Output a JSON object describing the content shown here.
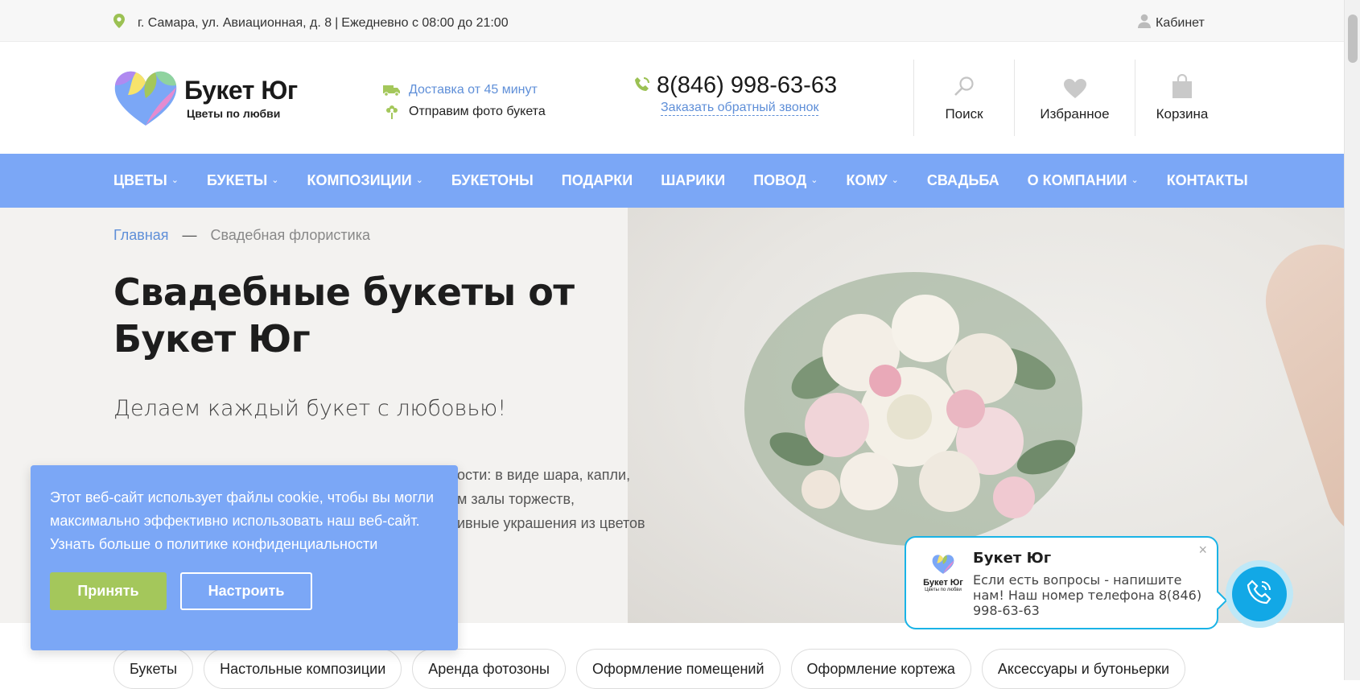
{
  "topbar": {
    "address": "г. Самара, ул. Авиационная, д. 8",
    "hours": "Ежедневно с 08:00 до 21:00",
    "cabinet": "Кабинет"
  },
  "header": {
    "logo_title": "Букет Юг",
    "logo_sub": "Цветы по любви",
    "delivery": "Доставка от 45 минут",
    "photo_send": "Отправим фото букета",
    "phone": "8(846) 998-63-63",
    "callback": "Заказать обратный звонок",
    "search": "Поиск",
    "favorites": "Избранное",
    "cart": "Корзина"
  },
  "nav": [
    {
      "label": "ЦВЕТЫ",
      "dropdown": true
    },
    {
      "label": "БУКЕТЫ",
      "dropdown": true
    },
    {
      "label": "КОМПОЗИЦИИ",
      "dropdown": true
    },
    {
      "label": "БУКЕТОНЫ",
      "dropdown": false
    },
    {
      "label": "ПОДАРКИ",
      "dropdown": false
    },
    {
      "label": "ШАРИКИ",
      "dropdown": false
    },
    {
      "label": "ПОВОД",
      "dropdown": true
    },
    {
      "label": "КОМУ",
      "dropdown": true
    },
    {
      "label": "СВАДЬБА",
      "dropdown": false
    },
    {
      "label": "О КОМПАНИИ",
      "dropdown": true
    },
    {
      "label": "КОНТАКТЫ",
      "dropdown": false
    }
  ],
  "breadcrumb": {
    "home": "Главная",
    "separator": "—",
    "current": "Свадебная флористика"
  },
  "hero": {
    "title": "Свадебные букеты от Букет Юг",
    "tagline": "Делаем каждый букет с любовью!",
    "desc_line1": "ости: в виде шара, капли,",
    "desc_line2": "м залы торжеств,",
    "desc_line3": "ивные украшения из цветов"
  },
  "cookie": {
    "text": "Этот веб-сайт использует файлы cookie, чтобы вы могли максимально эффективно использовать наш веб-сайт. Узнать больше о политике конфиденциальности",
    "accept": "Принять",
    "settings": "Настроить"
  },
  "tags": [
    "Букеты",
    "Настольные композиции",
    "Аренда фотозоны",
    "Оформление помещений",
    "Оформление кортежа",
    "Аксессуары и бутоньерки"
  ],
  "chat": {
    "name": "Букет Юг",
    "message": "Если есть вопросы - напишите нам! Наш номер телефона 8(846) 998-63-63",
    "close": "×",
    "logo_title": "Букет Юг",
    "logo_sub": "Цветы по любви"
  },
  "colors": {
    "nav_bg": "#7ba7f6",
    "accent_blue": "#5f8fd8",
    "accept_green": "#a4c75b",
    "chat_border": "#1ab3e6",
    "call_button": "#12a8e6"
  },
  "icons": {
    "pin": "map-pin-icon",
    "user": "user-icon",
    "truck": "truck-icon",
    "flower": "flower-icon",
    "phone": "phone-icon",
    "search": "search-icon",
    "heart": "heart-icon",
    "bag": "bag-icon",
    "call": "call-icon"
  }
}
